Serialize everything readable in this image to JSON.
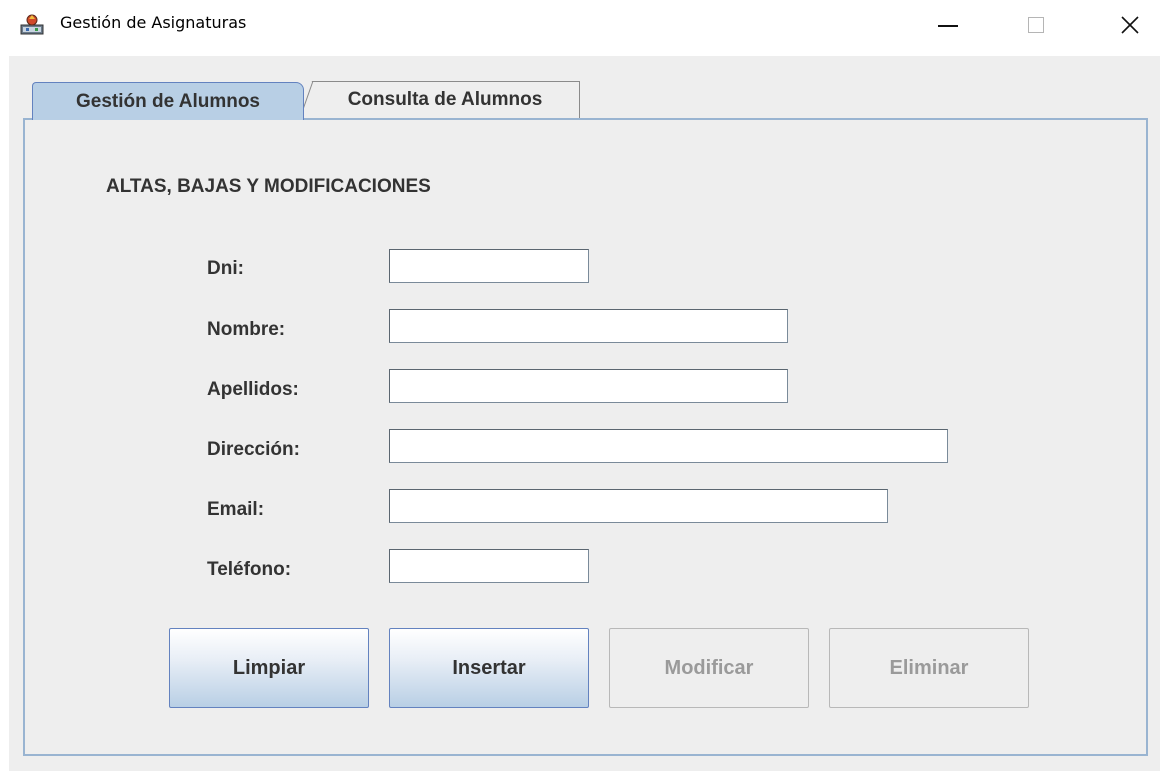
{
  "window": {
    "title": "Gestión de Asignaturas",
    "icons": {
      "app": "java-app-icon",
      "minimize": "minimize-icon",
      "maximize": "maximize-icon",
      "close": "close-icon"
    },
    "close_glyph": "✕"
  },
  "tabs": [
    {
      "label": "Gestión de Alumnos",
      "active": true
    },
    {
      "label": "Consulta de Alumnos",
      "active": false
    }
  ],
  "form": {
    "section_title": "ALTAS, BAJAS Y MODIFICACIONES",
    "fields": [
      {
        "label": "Dni:",
        "value": ""
      },
      {
        "label": "Nombre:",
        "value": ""
      },
      {
        "label": "Apellidos:",
        "value": ""
      },
      {
        "label": "Dirección:",
        "value": ""
      },
      {
        "label": "Email:",
        "value": ""
      },
      {
        "label": "Teléfono:",
        "value": ""
      }
    ]
  },
  "buttons": [
    {
      "label": "Limpiar",
      "enabled": true
    },
    {
      "label": "Insertar",
      "enabled": true
    },
    {
      "label": "Modificar",
      "enabled": false
    },
    {
      "label": "Eliminar",
      "enabled": false
    }
  ],
  "colors": {
    "accent": "#b8cfe5",
    "panel_border": "#99b4d1",
    "background": "#eeeeee",
    "disabled_text": "#9a9a9a"
  }
}
